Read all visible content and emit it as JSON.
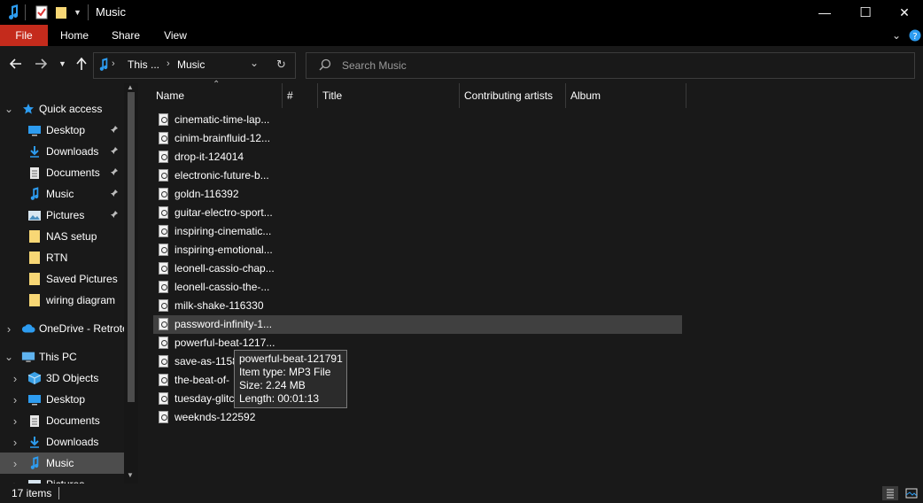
{
  "window": {
    "title": "Music",
    "quick_access_icons": [
      "music-note-icon",
      "properties-checklist-icon",
      "new-folder-icon",
      "customize-dropdown-icon"
    ],
    "controls": {
      "minimize": "—",
      "maximize": "☐",
      "close": "✕"
    }
  },
  "ribbon": {
    "tabs": [
      "File",
      "Home",
      "Share",
      "View"
    ],
    "expand_icon": "chevron-down-icon",
    "help_icon": "help-icon"
  },
  "address_bar": {
    "crumb_ellipsis": "This ...",
    "current": "Music",
    "separator": "›"
  },
  "search": {
    "placeholder": "Search Music"
  },
  "nav_pane": {
    "items": [
      {
        "label": "Quick access",
        "icon": "star-icon",
        "expanded": true,
        "pinned": false,
        "selected": false
      },
      {
        "label": "Desktop",
        "icon": "desktop-icon",
        "pinned": true,
        "selected": false
      },
      {
        "label": "Downloads",
        "icon": "download-arrow-icon",
        "pinned": true,
        "selected": false
      },
      {
        "label": "Documents",
        "icon": "document-icon",
        "pinned": true,
        "selected": false
      },
      {
        "label": "Music",
        "icon": "music-note-icon",
        "pinned": true,
        "selected": false
      },
      {
        "label": "Pictures",
        "icon": "pictures-icon",
        "pinned": true,
        "selected": false
      },
      {
        "label": "NAS setup",
        "icon": "folder-icon",
        "pinned": false,
        "selected": false
      },
      {
        "label": "RTN",
        "icon": "folder-icon",
        "pinned": false,
        "selected": false
      },
      {
        "label": "Saved Pictures",
        "icon": "folder-icon",
        "pinned": false,
        "selected": false
      },
      {
        "label": "wiring diagram",
        "icon": "folder-icon",
        "pinned": false,
        "selected": false
      },
      {
        "label": "OneDrive - Retrote",
        "icon": "cloud-icon",
        "expanded": false,
        "selected": false
      },
      {
        "label": "This PC",
        "icon": "computer-icon",
        "expanded": true,
        "selected": false
      },
      {
        "label": "3D Objects",
        "icon": "cube-icon",
        "expanded": false,
        "selected": false
      },
      {
        "label": "Desktop",
        "icon": "desktop-icon",
        "expanded": false,
        "selected": false
      },
      {
        "label": "Documents",
        "icon": "document-icon",
        "expanded": false,
        "selected": false
      },
      {
        "label": "Downloads",
        "icon": "download-arrow-icon",
        "expanded": false,
        "selected": false
      },
      {
        "label": "Music",
        "icon": "music-note-icon",
        "expanded": false,
        "selected": true
      },
      {
        "label": "Pictures",
        "icon": "pictures-icon",
        "expanded": false,
        "selected": false
      }
    ]
  },
  "columns": [
    "Name",
    "#",
    "Title",
    "Contributing artists",
    "Album"
  ],
  "files": [
    "cinematic-time-lap...",
    "cinim-brainfluid-12...",
    "drop-it-124014",
    "electronic-future-b...",
    "goldn-116392",
    "guitar-electro-sport...",
    "inspiring-cinematic...",
    "inspiring-emotional...",
    "leonell-cassio-chap...",
    "leonell-cassio-the-...",
    "milk-shake-116330",
    "password-infinity-1...",
    "powerful-beat-1217...",
    "save-as-1158",
    "the-beat-of-",
    "tuesday-glitc",
    "weeknds-122592"
  ],
  "selected_file_index": 11,
  "tooltip": {
    "name": "powerful-beat-121791",
    "type": "Item type: MP3 File",
    "size": "Size: 2.24 MB",
    "length": "Length: 00:01:13"
  },
  "status": {
    "count": "17 items",
    "views": [
      "details-view-icon",
      "large-icons-view-icon"
    ]
  },
  "colors": {
    "accent": "#c42b1c",
    "background": "#191919",
    "titlebar": "#000000",
    "selection": "#404040",
    "music_icon": "#2d9cf0",
    "folder": "#f8d775"
  }
}
